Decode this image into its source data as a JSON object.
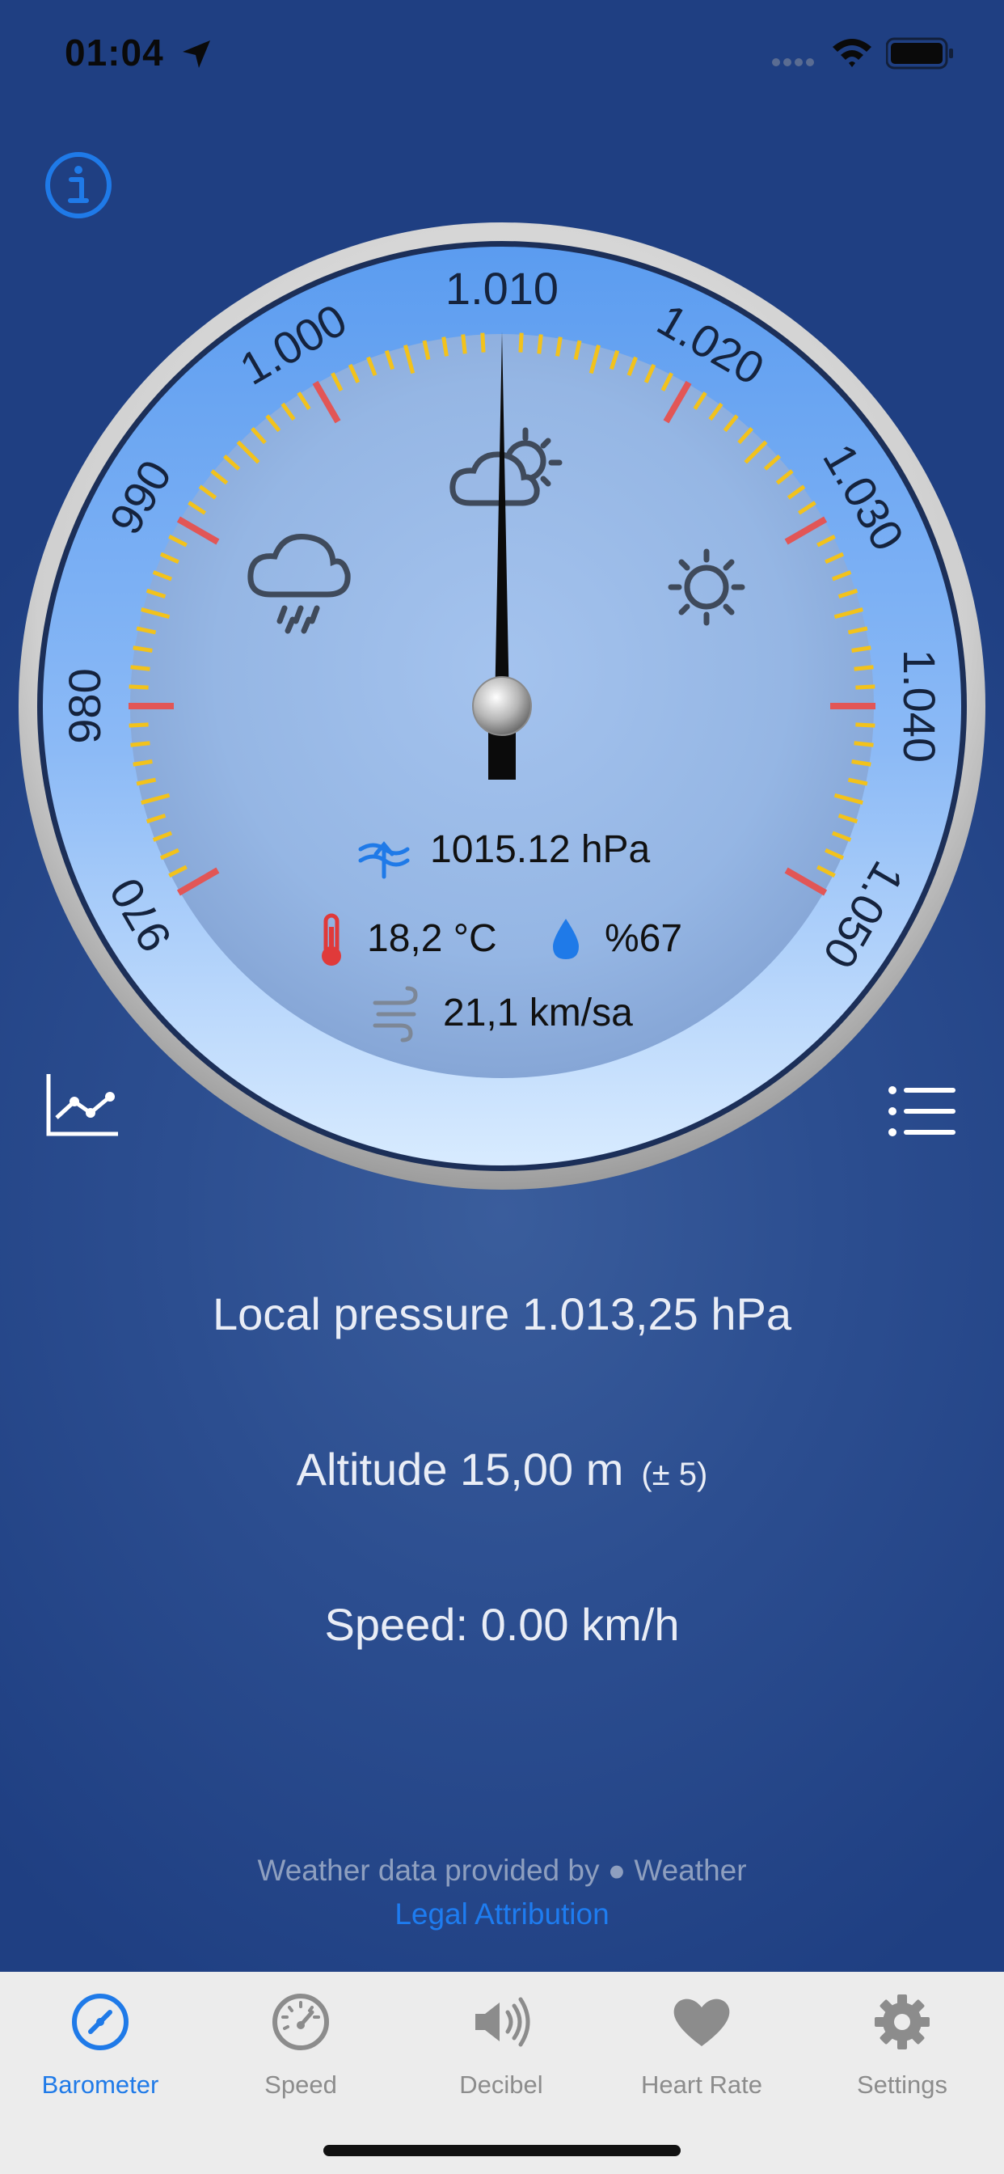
{
  "status_bar": {
    "time": "01:04"
  },
  "gauge": {
    "scale_labels": [
      "970",
      "980",
      "990",
      "1.000",
      "1.010",
      "1.020",
      "1.030",
      "1.040",
      "1.050"
    ],
    "pressure_reading": "1015.12 hPa",
    "temperature": "18,2 °C",
    "humidity": "%67",
    "wind": "21,1 km/sa",
    "needle_value_hpa": 1010
  },
  "readouts": {
    "local_pressure": "Local pressure 1.013,25 hPa",
    "altitude": "Altitude 15,00 m",
    "altitude_accuracy": "(± 5)",
    "speed": "Speed: 0.00 km/h"
  },
  "attribution": {
    "text_before": "Weather data provided by",
    "brand": "Weather",
    "link": "Legal Attribution"
  },
  "tabs": [
    {
      "label": "Barometer",
      "icon": "compass-icon",
      "active": true
    },
    {
      "label": "Speed",
      "icon": "speedometer-icon",
      "active": false
    },
    {
      "label": "Decibel",
      "icon": "speaker-icon",
      "active": false
    },
    {
      "label": "Heart Rate",
      "icon": "heart-icon",
      "active": false
    },
    {
      "label": "Settings",
      "icon": "gear-icon",
      "active": false
    }
  ],
  "colors": {
    "accent": "#1f7ae8",
    "background": "#2c4e90",
    "tick_major": "#e25656",
    "tick_minor": "#f2c21c"
  }
}
